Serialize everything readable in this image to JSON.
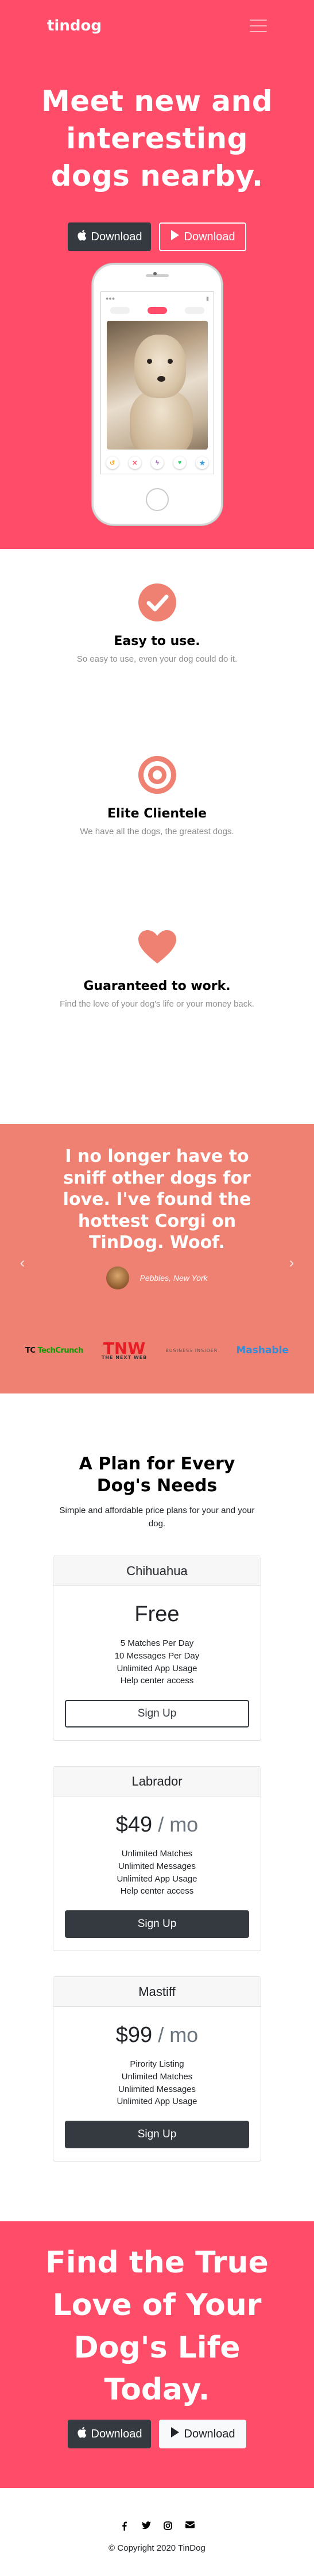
{
  "nav": {
    "brand": "tindog",
    "toggler_icon": "hamburger-icon"
  },
  "hero": {
    "title": "Meet new and interesting dogs nearby.",
    "download_apple": {
      "icon": "apple-icon",
      "label": "Download"
    },
    "download_google": {
      "icon": "google-play-icon",
      "label": "Download"
    }
  },
  "features": [
    {
      "icon": "check-circle-icon",
      "title": "Easy to use.",
      "text": "So easy to use, even your dog could do it."
    },
    {
      "icon": "bullseye-icon",
      "title": "Elite Clientele",
      "text": "We have all the dogs, the greatest dogs."
    },
    {
      "icon": "heart-icon",
      "title": "Guaranteed to work.",
      "text": "Find the love of your dog's life or your money back."
    }
  ],
  "testimonial": {
    "quote": "I no longer have to sniff other dogs for love. I've found the hottest Corgi on TinDog. Woof.",
    "author": "Pebbles, New York"
  },
  "press": [
    "TechCrunch",
    "TNW",
    "BUSINESS INSIDER",
    "Mashable"
  ],
  "pricing": {
    "title": "A Plan for Every Dog's Needs",
    "subtitle": "Simple and affordable price plans for your and your dog.",
    "plans": [
      {
        "name": "Chihuahua",
        "price": "Free",
        "per": "",
        "features": [
          "5 Matches Per Day",
          "10 Messages Per Day",
          "Unlimited App Usage",
          "Help center access"
        ],
        "button": "Sign Up"
      },
      {
        "name": "Labrador",
        "price": "$49",
        "per": " / mo",
        "features": [
          "Unlimited Matches",
          "Unlimited Messages",
          "Unlimited App Usage",
          "Help center access"
        ],
        "button": "Sign Up"
      },
      {
        "name": "Mastiff",
        "price": "$99",
        "per": " / mo",
        "features": [
          "Pirority Listing",
          "Unlimited Matches",
          "Unlimited Messages",
          "Unlimited App Usage"
        ],
        "button": "Sign Up"
      }
    ]
  },
  "cta": {
    "title": "Find the True Love of Your Dog's Life Today.",
    "download_apple": {
      "icon": "apple-icon",
      "label": "Download"
    },
    "download_google": {
      "icon": "google-play-icon",
      "label": "Download"
    }
  },
  "footer": {
    "social_icons": [
      "facebook-icon",
      "twitter-icon",
      "instagram-icon",
      "envelope-icon"
    ],
    "copyright": "© Copyright 2020 TinDog"
  },
  "colors": {
    "brand_red": "#ff4c68",
    "testimonial_bg": "#ef8172",
    "accent_coral": "#ef8172",
    "dark": "#343a40"
  }
}
